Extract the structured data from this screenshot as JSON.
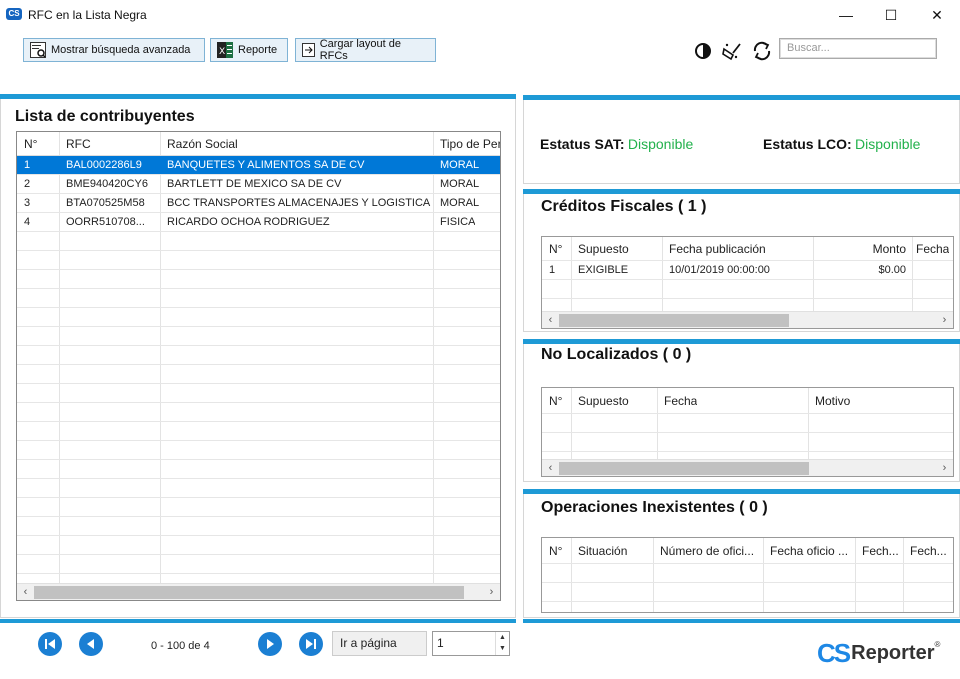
{
  "window": {
    "title": "RFC en la Lista Negra",
    "logo_text": "CS",
    "minimize": "—",
    "maximize": "☐",
    "close": "✕"
  },
  "toolbar": {
    "advanced_search": "Mostrar búsqueda avanzada",
    "report": "Reporte",
    "load_layout": "Cargar layout de RFCs",
    "search_placeholder": "Buscar..."
  },
  "left": {
    "title": "Lista de contribuyentes",
    "columns": [
      "N°",
      "RFC",
      "Razón Social",
      "Tipo de Per"
    ],
    "rows": [
      {
        "n": "1",
        "rfc": "BAL0002286L9",
        "razon": "BANQUETES Y ALIMENTOS SA DE CV",
        "tipo": "MORAL"
      },
      {
        "n": "2",
        "rfc": "BME940420CY6",
        "razon": "BARTLETT DE MEXICO SA DE CV",
        "tipo": "MORAL"
      },
      {
        "n": "3",
        "rfc": "BTA070525M58",
        "razon": "BCC TRANSPORTES ALMACENAJES Y LOGISTICA ...",
        "tipo": "MORAL"
      },
      {
        "n": "4",
        "rfc": "OORR510708...",
        "razon": "RICARDO OCHOA RODRIGUEZ",
        "tipo": "FISICA"
      }
    ],
    "selected_row": 0
  },
  "status": {
    "sat_label": "Estatus SAT:",
    "sat_value": "Disponible",
    "lco_label": "Estatus LCO:",
    "lco_value": "Disponible",
    "ok_color": "#22b14c"
  },
  "creditos": {
    "title": "Créditos Fiscales ( 1 )",
    "columns": [
      "N°",
      "Supuesto",
      "Fecha publicación",
      "Monto",
      "Fecha"
    ],
    "rows": [
      {
        "n": "1",
        "supuesto": "EXIGIBLE",
        "fecha": "10/01/2019 00:00:00",
        "monto": "$0.00",
        "fecha2": ""
      }
    ]
  },
  "no_localizados": {
    "title": "No Localizados ( 0 )",
    "columns": [
      "N°",
      "Supuesto",
      "Fecha",
      "Motivo"
    ]
  },
  "operaciones": {
    "title": "Operaciones Inexistentes ( 0 )",
    "columns": [
      "N°",
      "Situación",
      "Número de ofici...",
      "Fecha oficio ...",
      "Fech...",
      "Fech..."
    ]
  },
  "pager": {
    "range": "0 - 100 de 4",
    "goto_label": "Ir a página",
    "page_value": "1"
  },
  "brand": {
    "logo_text": "CS",
    "name": "Reporter",
    "reg": "®",
    "accent": "#1e9ad6"
  }
}
